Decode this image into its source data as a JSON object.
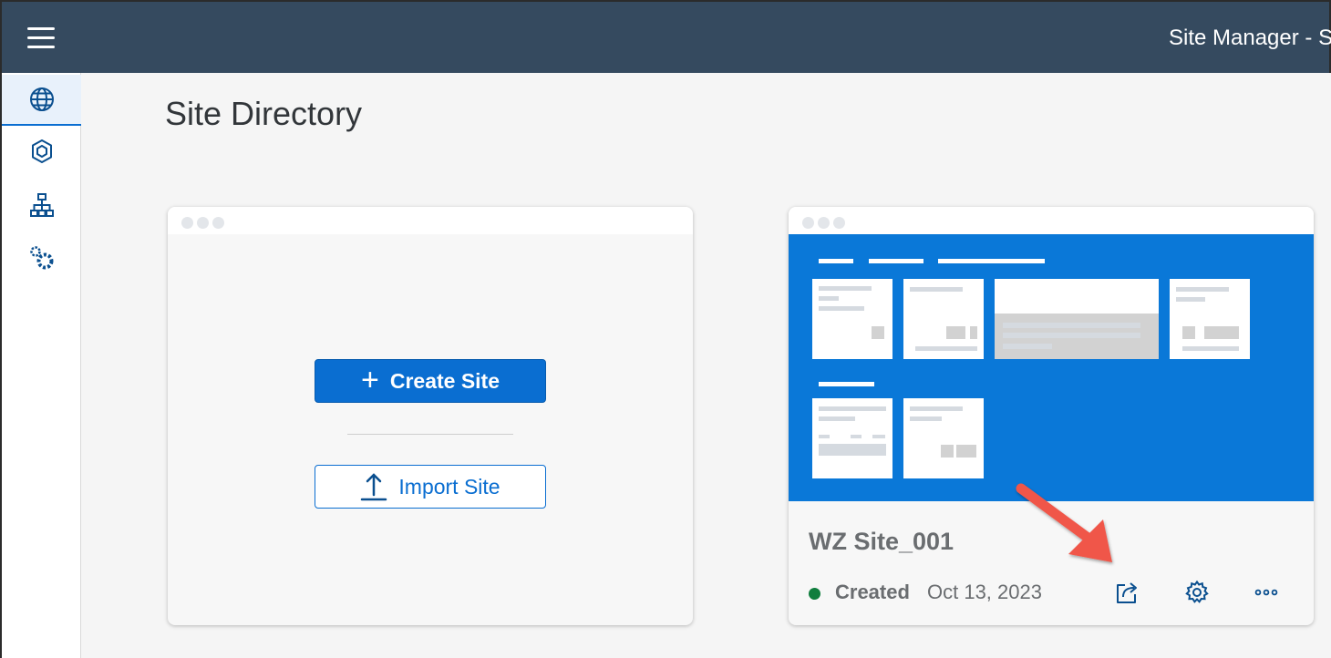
{
  "shell": {
    "title": "Site Manager - S"
  },
  "sidebar": {
    "items": [
      {
        "icon": "globe-icon",
        "active": true
      },
      {
        "icon": "content-icon",
        "active": false
      },
      {
        "icon": "hierarchy-icon",
        "active": false
      },
      {
        "icon": "settings-gears-icon",
        "active": false
      }
    ]
  },
  "page": {
    "title": "Site Directory"
  },
  "new_site_card": {
    "create_label": "Create Site",
    "import_label": "Import Site"
  },
  "site_card": {
    "name": "WZ Site_001",
    "status": "Created",
    "date": "Oct 13, 2023",
    "status_color": "#107e3e",
    "actions": [
      "share-icon",
      "settings-icon",
      "more-icon"
    ]
  },
  "colors": {
    "accent": "#0a6ed1",
    "shell": "#354a5f",
    "annotation_arrow": "#f0564a"
  }
}
